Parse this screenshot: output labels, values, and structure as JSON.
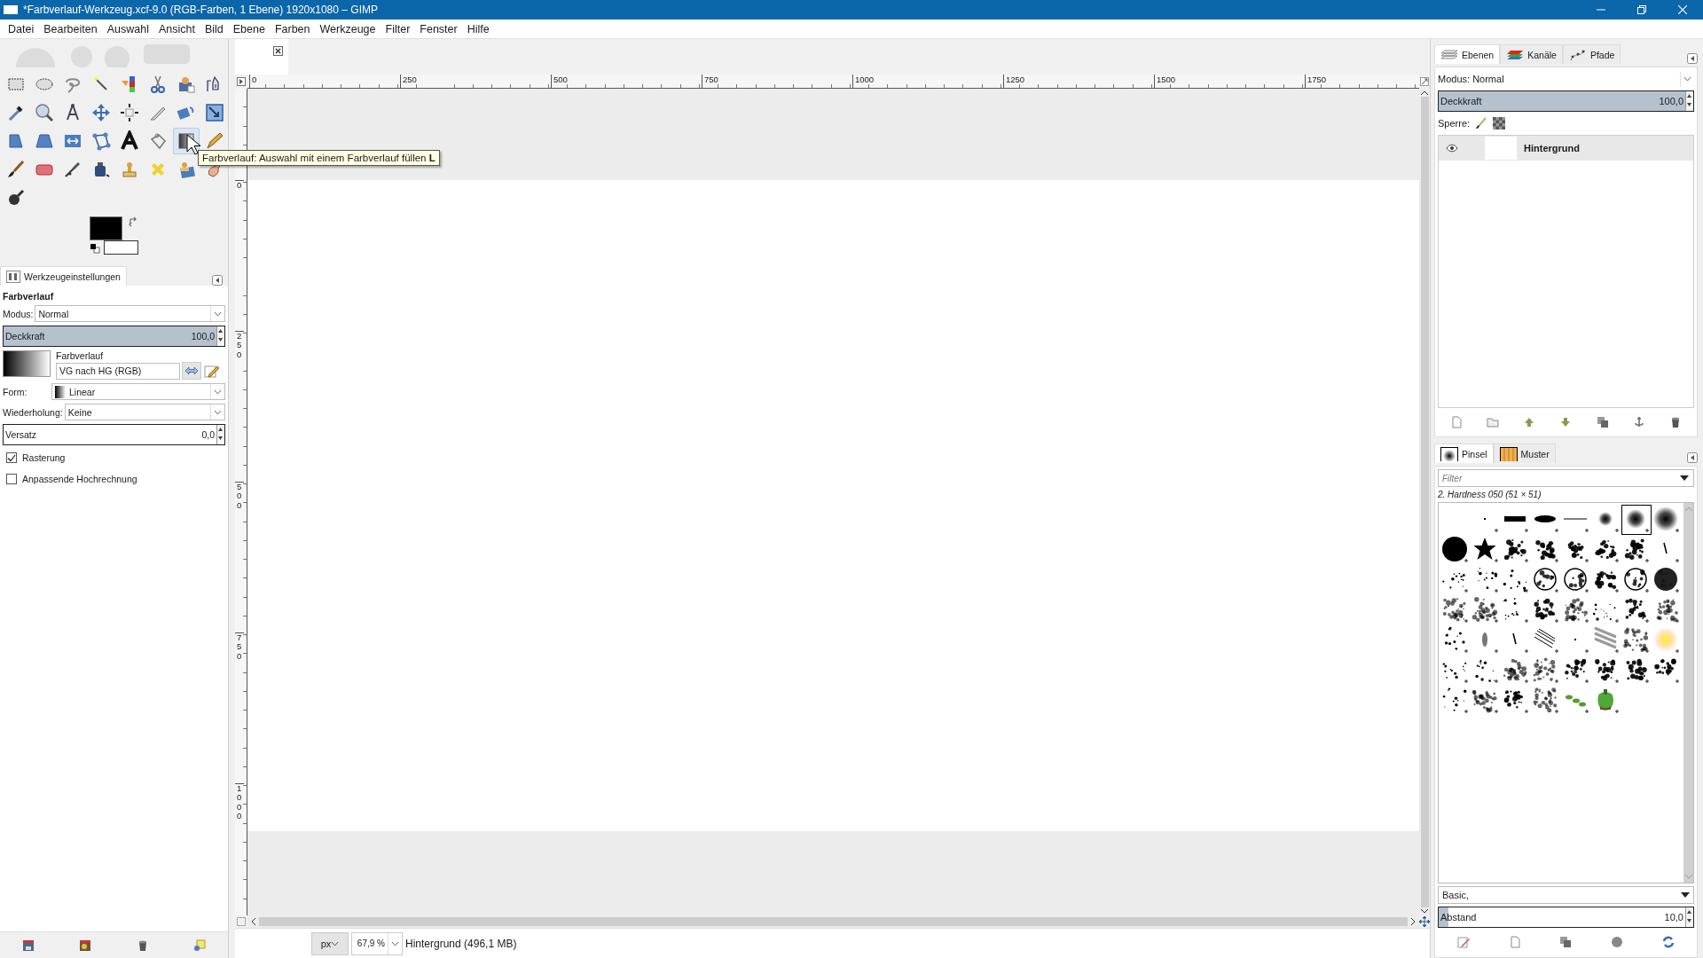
{
  "window": {
    "title": "*Farbverlauf-Werkzeug.xcf-9.0 (RGB-Farben, 1 Ebene) 1920x1080 – GIMP"
  },
  "menu": [
    "Datei",
    "Bearbeiten",
    "Auswahl",
    "Ansicht",
    "Bild",
    "Ebene",
    "Farben",
    "Werkzeuge",
    "Filter",
    "Fenster",
    "Hilfe"
  ],
  "toolbox": {
    "tools": [
      {
        "kind": "rect-select",
        "selected": false
      },
      {
        "kind": "ellipse-select",
        "selected": false
      },
      {
        "kind": "lasso",
        "selected": false
      },
      {
        "kind": "wand",
        "selected": false
      },
      {
        "kind": "color-select",
        "selected": false
      },
      {
        "kind": "scissors",
        "selected": false
      },
      {
        "kind": "fg-select",
        "selected": false
      },
      {
        "kind": "paths",
        "selected": false
      },
      {
        "kind": "picker",
        "selected": false
      },
      {
        "kind": "zoom",
        "selected": false
      },
      {
        "kind": "measure",
        "selected": false
      },
      {
        "kind": "move",
        "selected": false
      },
      {
        "kind": "align",
        "selected": false
      },
      {
        "kind": "crop",
        "selected": false
      },
      {
        "kind": "transform",
        "selected": false
      },
      {
        "kind": "scale",
        "selected": false
      },
      {
        "kind": "perspective",
        "selected": false
      },
      {
        "kind": "warp",
        "selected": false
      },
      {
        "kind": "flip",
        "selected": false
      },
      {
        "kind": "cage",
        "selected": false
      },
      {
        "kind": "text",
        "selected": false
      },
      {
        "kind": "bucket",
        "selected": false
      },
      {
        "kind": "gradient",
        "selected": true
      },
      {
        "kind": "pencil",
        "selected": false
      },
      {
        "kind": "brush",
        "selected": false
      },
      {
        "kind": "eraser",
        "selected": false
      },
      {
        "kind": "airbrush",
        "selected": false
      },
      {
        "kind": "ink",
        "selected": false
      },
      {
        "kind": "clone",
        "selected": false
      },
      {
        "kind": "heal",
        "selected": false
      },
      {
        "kind": "persp-clone",
        "selected": false
      },
      {
        "kind": "smudge",
        "selected": false
      },
      {
        "kind": "dodge",
        "selected": false
      }
    ]
  },
  "colors": [
    {
      "kind": "foreground",
      "color": "#000000"
    },
    {
      "kind": "background",
      "color": "#ffffff"
    }
  ],
  "tooltip": {
    "text": "Farbverlauf: Auswahl mit einem Farbverlauf füllen  **L**"
  },
  "tool_options": {
    "tab": "Werkzeugeinstellungen",
    "heading": "Farbverlauf",
    "mode_label": "Modus:",
    "mode": "Normal",
    "opacity": {
      "label": "Deckkraft",
      "value": "100,0",
      "level": 1
    },
    "gradient_label": "Farbverlauf",
    "gradient": "VG nach HG (RGB)",
    "shape_label": "Form:",
    "shape": "Linear",
    "repeat_label": "Wiederholung:",
    "repeat": "Keine",
    "offset": {
      "label": "Versatz",
      "value": "0,0",
      "level": 0
    },
    "options": [
      {
        "label": "Rasterung",
        "checked": true
      },
      {
        "label": "Anpassende Hochrechnung",
        "checked": false
      }
    ]
  },
  "rulers": {
    "horizontal": [
      "0",
      "250",
      "500",
      "750",
      "1000",
      "1250",
      "1500",
      "1750"
    ],
    "vertical": [
      "0",
      "250",
      "500",
      "750",
      "1000"
    ]
  },
  "status_bar": {
    "unit": "px",
    "zoom": "67,9 %",
    "info": "Hintergrund (496,1 MB)"
  },
  "layers_dock": {
    "tabs": [
      {
        "label": "Ebenen",
        "selected": true
      },
      {
        "label": "Kanäle",
        "selected": false
      },
      {
        "label": "Pfade",
        "selected": false
      }
    ],
    "mode": "Modus: Normal",
    "opacity": {
      "label": "Deckkraft",
      "value": "100,0",
      "level": 1
    },
    "lock_label": "Sperre:",
    "layers": [
      {
        "name": "Hintergrund",
        "visible": true,
        "selected": true
      }
    ]
  },
  "brushes_dock": {
    "tabs": [
      {
        "label": "Pinsel",
        "selected": true
      },
      {
        "label": "Muster",
        "selected": false
      }
    ],
    "filter_placeholder": "Filter",
    "brush_name": "2. Hardness 050 (51 × 51)",
    "brushes": [
      {
        "kind": "dot",
        "selected": false
      },
      {
        "kind": "bar",
        "selected": false
      },
      {
        "kind": "ellipse",
        "selected": false
      },
      {
        "kind": "line",
        "selected": false
      },
      {
        "kind": "soft-small",
        "selected": false
      },
      {
        "kind": "soft-medium",
        "selected": true
      },
      {
        "kind": "soft-large",
        "selected": false
      },
      {
        "kind": "disc",
        "selected": false
      },
      {
        "kind": "star",
        "selected": false
      },
      {
        "kind": "splatter",
        "selected": false
      },
      {
        "kind": "splatter",
        "selected": false
      },
      {
        "kind": "splatter",
        "selected": false
      },
      {
        "kind": "splatter",
        "selected": false
      },
      {
        "kind": "splatter",
        "selected": false
      },
      {
        "kind": "dash",
        "selected": false
      },
      {
        "kind": "scatter",
        "selected": false
      },
      {
        "kind": "scatter",
        "selected": false
      },
      {
        "kind": "scatter",
        "selected": false
      },
      {
        "kind": "cells",
        "selected": false
      },
      {
        "kind": "cells",
        "selected": false
      },
      {
        "kind": "splatter",
        "selected": false
      },
      {
        "kind": "cells",
        "selected": false
      },
      {
        "kind": "ball",
        "selected": false
      },
      {
        "kind": "texture",
        "selected": false
      },
      {
        "kind": "texture",
        "selected": false
      },
      {
        "kind": "scatter",
        "selected": false
      },
      {
        "kind": "splatter",
        "selected": false
      },
      {
        "kind": "texture",
        "selected": false
      },
      {
        "kind": "scatter",
        "selected": false
      },
      {
        "kind": "splatter",
        "selected": false
      },
      {
        "kind": "texture",
        "selected": false
      },
      {
        "kind": "scatter",
        "selected": false
      },
      {
        "kind": "smear",
        "selected": false
      },
      {
        "kind": "dash",
        "selected": false
      },
      {
        "kind": "stripes",
        "selected": false
      },
      {
        "kind": "dot",
        "selected": false
      },
      {
        "kind": "waves",
        "selected": false
      },
      {
        "kind": "texture",
        "selected": false
      },
      {
        "kind": "glow",
        "selected": false
      },
      {
        "kind": "scatter",
        "selected": false
      },
      {
        "kind": "scatter",
        "selected": false
      },
      {
        "kind": "texture",
        "selected": false
      },
      {
        "kind": "texture",
        "selected": false
      },
      {
        "kind": "splatter",
        "selected": false
      },
      {
        "kind": "splatter",
        "selected": false
      },
      {
        "kind": "splatter",
        "selected": false
      },
      {
        "kind": "splatter",
        "selected": false
      },
      {
        "kind": "scatter",
        "selected": false
      },
      {
        "kind": "texture",
        "selected": false
      },
      {
        "kind": "splatter",
        "selected": false
      },
      {
        "kind": "texture",
        "selected": false
      },
      {
        "kind": "leaves",
        "selected": false
      },
      {
        "kind": "pepper",
        "selected": false
      }
    ],
    "tag": "Basic,",
    "spacing": {
      "label": "Abstand",
      "value": "10,0",
      "level": 0.04
    }
  }
}
